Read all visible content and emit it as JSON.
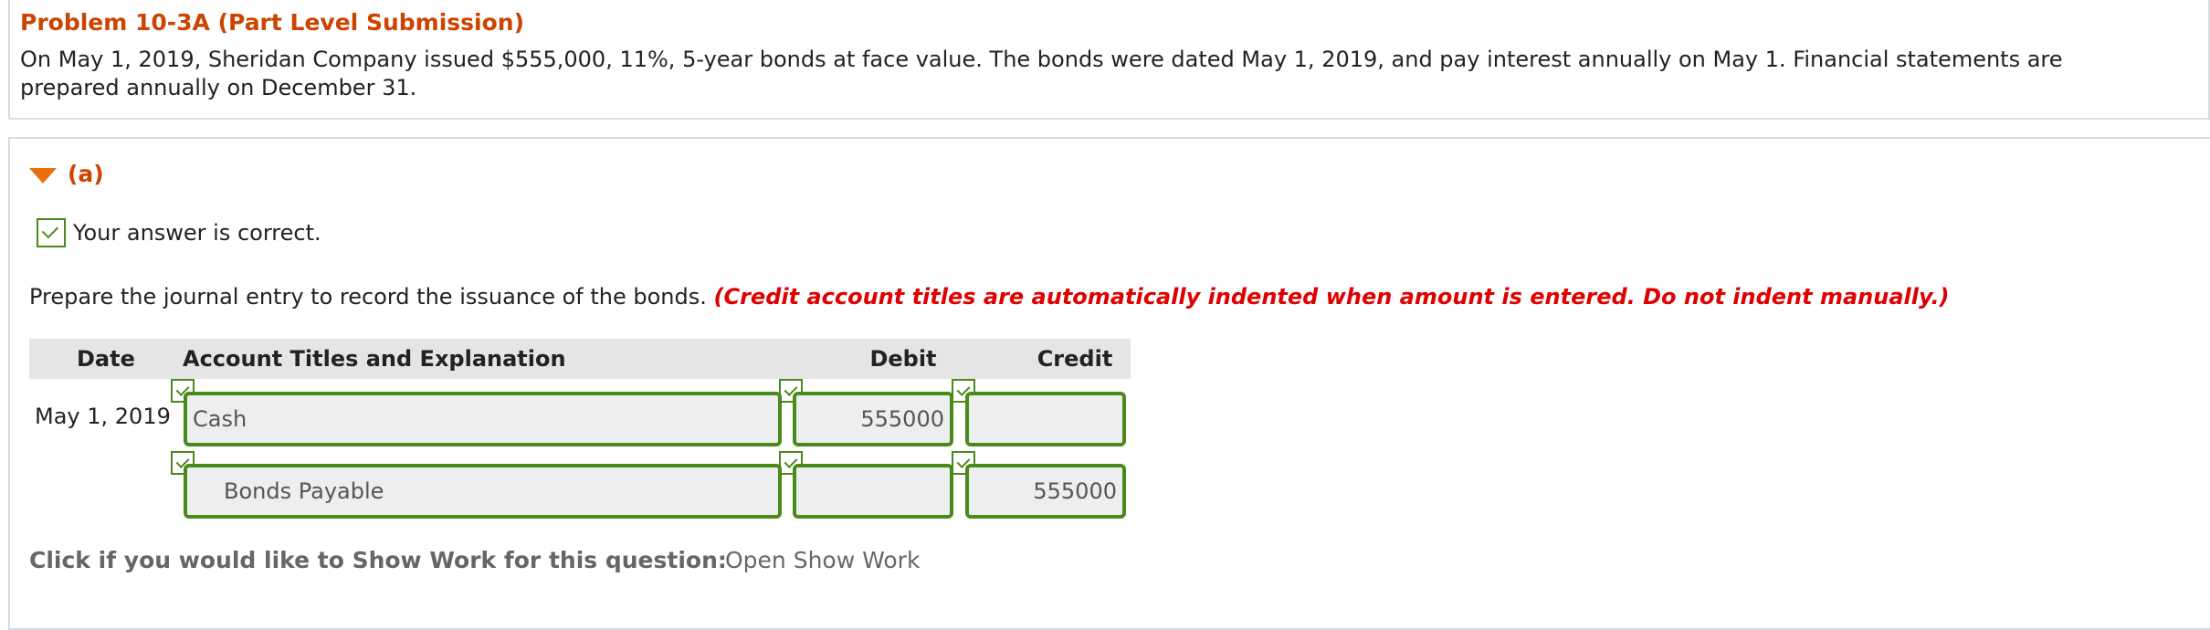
{
  "problem": {
    "title": "Problem 10-3A (Part Level Submission)",
    "text": "On May 1, 2019, Sheridan Company issued $555,000, 11%, 5-year bonds at face value. The bonds were dated May 1, 2019, and pay interest annually on May 1. Financial statements are prepared annually on December 31."
  },
  "part": {
    "label": "(a)",
    "status_text": "Your answer is correct.",
    "instruction": "Prepare the journal entry to record the issuance of the bonds.",
    "instruction_note": "(Credit account titles are automatically indented when amount is entered. Do not indent manually.)"
  },
  "journal": {
    "headers": {
      "date": "Date",
      "account": "Account Titles and Explanation",
      "debit": "Debit",
      "credit": "Credit"
    },
    "rows": [
      {
        "date": "May 1, 2019",
        "account": "Cash",
        "debit": "555000",
        "credit": ""
      },
      {
        "date": "",
        "account": "Bonds Payable",
        "debit": "",
        "credit": "555000"
      }
    ]
  },
  "show_work": {
    "prompt": "Click if you would like to Show Work for this question:",
    "link": "Open Show Work"
  },
  "colors": {
    "title": "#cc4400",
    "arrow": "#e8700c",
    "correct_green": "#4a8a1a",
    "note_red": "#e00000"
  },
  "icons": {
    "collapse": "triangle-down-icon",
    "status": "checkmark-icon"
  }
}
